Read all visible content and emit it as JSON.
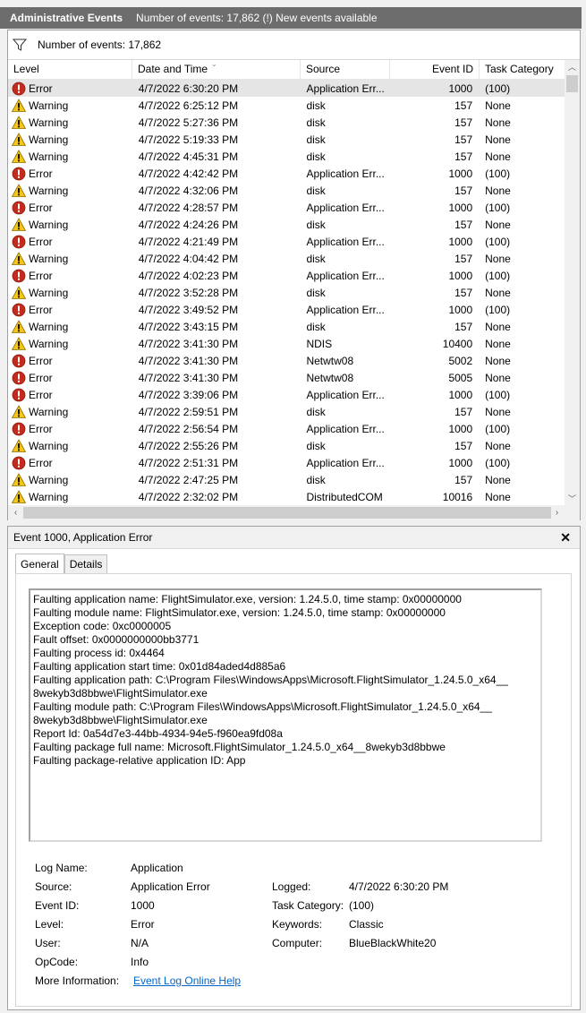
{
  "title": {
    "name": "Administrative Events",
    "subtitle": "Number of events: 17,862 (!) New events available"
  },
  "filter": {
    "text": "Number of events: 17,862"
  },
  "columns": {
    "level": "Level",
    "date": "Date and Time",
    "source": "Source",
    "event_id": "Event ID",
    "category": "Task Category"
  },
  "events": [
    {
      "level": "Error",
      "date": "4/7/2022 6:30:20 PM",
      "source": "Application Err...",
      "id": "1000",
      "cat": "(100)"
    },
    {
      "level": "Warning",
      "date": "4/7/2022 6:25:12 PM",
      "source": "disk",
      "id": "157",
      "cat": "None"
    },
    {
      "level": "Warning",
      "date": "4/7/2022 5:27:36 PM",
      "source": "disk",
      "id": "157",
      "cat": "None"
    },
    {
      "level": "Warning",
      "date": "4/7/2022 5:19:33 PM",
      "source": "disk",
      "id": "157",
      "cat": "None"
    },
    {
      "level": "Warning",
      "date": "4/7/2022 4:45:31 PM",
      "source": "disk",
      "id": "157",
      "cat": "None"
    },
    {
      "level": "Error",
      "date": "4/7/2022 4:42:42 PM",
      "source": "Application Err...",
      "id": "1000",
      "cat": "(100)"
    },
    {
      "level": "Warning",
      "date": "4/7/2022 4:32:06 PM",
      "source": "disk",
      "id": "157",
      "cat": "None"
    },
    {
      "level": "Error",
      "date": "4/7/2022 4:28:57 PM",
      "source": "Application Err...",
      "id": "1000",
      "cat": "(100)"
    },
    {
      "level": "Warning",
      "date": "4/7/2022 4:24:26 PM",
      "source": "disk",
      "id": "157",
      "cat": "None"
    },
    {
      "level": "Error",
      "date": "4/7/2022 4:21:49 PM",
      "source": "Application Err...",
      "id": "1000",
      "cat": "(100)"
    },
    {
      "level": "Warning",
      "date": "4/7/2022 4:04:42 PM",
      "source": "disk",
      "id": "157",
      "cat": "None"
    },
    {
      "level": "Error",
      "date": "4/7/2022 4:02:23 PM",
      "source": "Application Err...",
      "id": "1000",
      "cat": "(100)"
    },
    {
      "level": "Warning",
      "date": "4/7/2022 3:52:28 PM",
      "source": "disk",
      "id": "157",
      "cat": "None"
    },
    {
      "level": "Error",
      "date": "4/7/2022 3:49:52 PM",
      "source": "Application Err...",
      "id": "1000",
      "cat": "(100)"
    },
    {
      "level": "Warning",
      "date": "4/7/2022 3:43:15 PM",
      "source": "disk",
      "id": "157",
      "cat": "None"
    },
    {
      "level": "Warning",
      "date": "4/7/2022 3:41:30 PM",
      "source": "NDIS",
      "id": "10400",
      "cat": "None"
    },
    {
      "level": "Error",
      "date": "4/7/2022 3:41:30 PM",
      "source": "Netwtw08",
      "id": "5002",
      "cat": "None"
    },
    {
      "level": "Error",
      "date": "4/7/2022 3:41:30 PM",
      "source": "Netwtw08",
      "id": "5005",
      "cat": "None"
    },
    {
      "level": "Error",
      "date": "4/7/2022 3:39:06 PM",
      "source": "Application Err...",
      "id": "1000",
      "cat": "(100)"
    },
    {
      "level": "Warning",
      "date": "4/7/2022 2:59:51 PM",
      "source": "disk",
      "id": "157",
      "cat": "None"
    },
    {
      "level": "Error",
      "date": "4/7/2022 2:56:54 PM",
      "source": "Application Err...",
      "id": "1000",
      "cat": "(100)"
    },
    {
      "level": "Warning",
      "date": "4/7/2022 2:55:26 PM",
      "source": "disk",
      "id": "157",
      "cat": "None"
    },
    {
      "level": "Error",
      "date": "4/7/2022 2:51:31 PM",
      "source": "Application Err...",
      "id": "1000",
      "cat": "(100)"
    },
    {
      "level": "Warning",
      "date": "4/7/2022 2:47:25 PM",
      "source": "disk",
      "id": "157",
      "cat": "None"
    },
    {
      "level": "Warning",
      "date": "4/7/2022 2:32:02 PM",
      "source": "DistributedCOM",
      "id": "10016",
      "cat": "None"
    }
  ],
  "detail": {
    "header": "Event 1000, Application Error",
    "tabs": [
      "General",
      "Details"
    ],
    "description": [
      "Faulting application name: FlightSimulator.exe, version: 1.24.5.0, time stamp: 0x00000000",
      "Faulting module name: FlightSimulator.exe, version: 1.24.5.0, time stamp: 0x00000000",
      "Exception code: 0xc0000005",
      "Fault offset: 0x0000000000bb3771",
      "Faulting process id: 0x4464",
      "Faulting application start time: 0x01d84aded4d885a6",
      "Faulting application path: C:\\Program Files\\WindowsApps\\Microsoft.FlightSimulator_1.24.5.0_x64__",
      "8wekyb3d8bbwe\\FlightSimulator.exe",
      "Faulting module path: C:\\Program Files\\WindowsApps\\Microsoft.FlightSimulator_1.24.5.0_x64__",
      "8wekyb3d8bbwe\\FlightSimulator.exe",
      "Report Id: 0a54d7e3-44bb-4934-94e5-f960ea9fd08a",
      "Faulting package full name: Microsoft.FlightSimulator_1.24.5.0_x64__8wekyb3d8bbwe",
      "Faulting package-relative application ID: App"
    ],
    "props": {
      "log_name_label": "Log Name:",
      "log_name": "Application",
      "source_label": "Source:",
      "source": "Application Error",
      "logged_label": "Logged:",
      "logged": "4/7/2022 6:30:20 PM",
      "event_id_label": "Event ID:",
      "event_id": "1000",
      "task_cat_label": "Task Category:",
      "task_cat": "(100)",
      "level_label": "Level:",
      "level": "Error",
      "keywords_label": "Keywords:",
      "keywords": "Classic",
      "user_label": "User:",
      "user": "N/A",
      "computer_label": "Computer:",
      "computer": "BlueBlackWhite20",
      "opcode_label": "OpCode:",
      "opcode": "Info",
      "more_info_label": "More Information:",
      "more_info": "Event Log Online Help"
    }
  }
}
